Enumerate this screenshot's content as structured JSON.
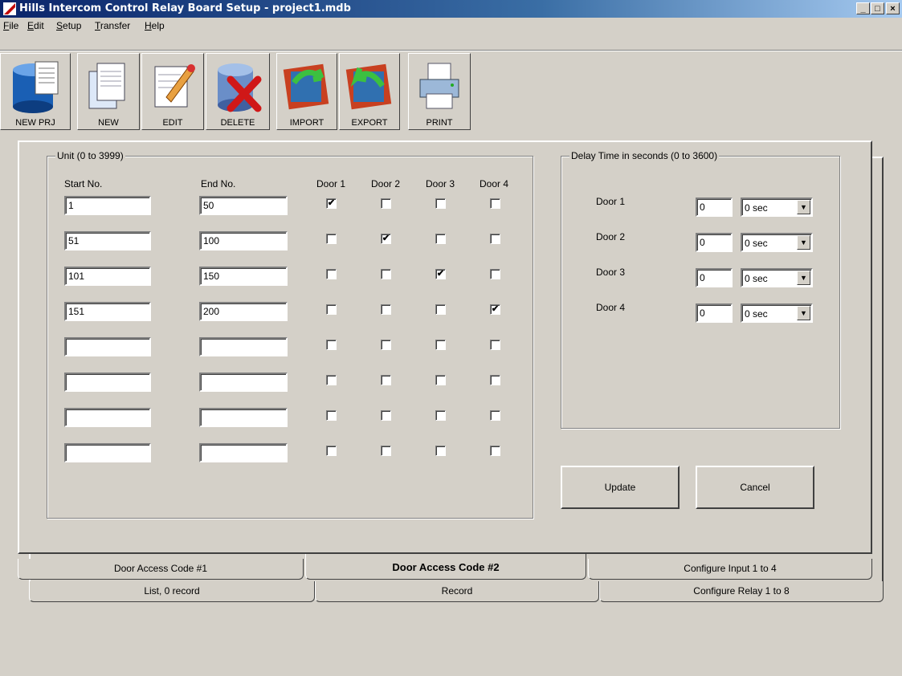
{
  "window": {
    "title": "Hills Intercom Control Relay Board Setup - project1.mdb",
    "minimize": "_",
    "maximize": "□",
    "close": "×"
  },
  "menu": [
    {
      "u": "F",
      "rest": "ile"
    },
    {
      "u": "E",
      "rest": "dit"
    },
    {
      "u": "S",
      "rest": "etup"
    },
    {
      "u": "T",
      "rest": "ransfer"
    },
    {
      "u": "H",
      "rest": "elp"
    }
  ],
  "toolbar": {
    "new_prj": "NEW PRJ",
    "new": "NEW",
    "edit": "EDIT",
    "delete": "DELETE",
    "import": "IMPORT",
    "export": "EXPORT",
    "print": "PRINT"
  },
  "unit_group": {
    "title": "Unit (0 to 3999)",
    "start_label": "Start No.",
    "end_label": "End No.",
    "door_labels": [
      "Door 1",
      "Door 2",
      "Door 3",
      "Door 4"
    ],
    "rows": [
      {
        "start": "1",
        "end": "50",
        "doors": [
          "✔",
          "",
          "",
          ""
        ]
      },
      {
        "start": "51",
        "end": "100",
        "doors": [
          "",
          "✔",
          "",
          ""
        ]
      },
      {
        "start": "101",
        "end": "150",
        "doors": [
          "",
          "",
          "✔",
          ""
        ]
      },
      {
        "start": "151",
        "end": "200",
        "doors": [
          "",
          "",
          "",
          "✔"
        ]
      },
      {
        "start": "",
        "end": "",
        "doors": [
          "",
          "",
          "",
          ""
        ]
      },
      {
        "start": "",
        "end": "",
        "doors": [
          "",
          "",
          "",
          ""
        ]
      },
      {
        "start": "",
        "end": "",
        "doors": [
          "",
          "",
          "",
          ""
        ]
      },
      {
        "start": "",
        "end": "",
        "doors": [
          "",
          "",
          "",
          ""
        ]
      }
    ]
  },
  "delay_group": {
    "title": "Delay Time in seconds (0 to 3600)",
    "rows": [
      {
        "label": "Door 1",
        "value": "0",
        "unit": "0 sec"
      },
      {
        "label": "Door 2",
        "value": "0",
        "unit": "0 sec"
      },
      {
        "label": "Door 3",
        "value": "0",
        "unit": "0 sec"
      },
      {
        "label": "Door 4",
        "value": "0",
        "unit": "0 sec"
      }
    ]
  },
  "buttons": {
    "update": "Update",
    "cancel": "Cancel"
  },
  "tabs_front": [
    "Door Access Code #1",
    "Door Access Code #2",
    "Configure Input 1 to 4"
  ],
  "tabs_back": [
    "List,  0 record",
    "Record",
    "Configure Relay 1 to 8"
  ],
  "colors": {
    "titlebar_start": "#0a246a",
    "titlebar_end": "#a6caf0",
    "face": "#d4d0c8"
  }
}
